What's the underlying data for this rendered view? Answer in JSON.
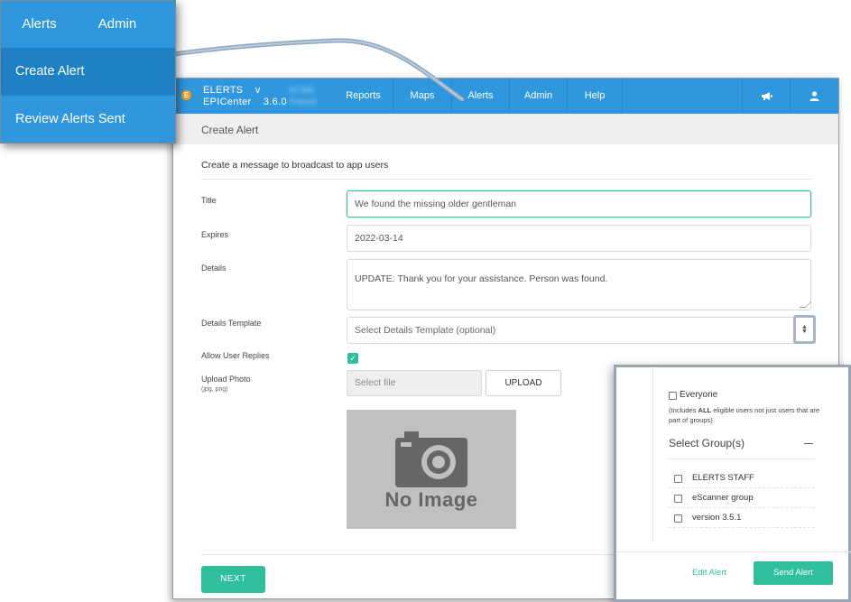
{
  "dropdown": {
    "tabs": [
      "Alerts",
      "Admin"
    ],
    "items": [
      "Create Alert",
      "Review Alerts Sent"
    ]
  },
  "navbar": {
    "logo_letter": "E",
    "brand_line1": "ELERTS",
    "brand_line2": "EPICenter",
    "version_label": "v",
    "version_number": "3.6.0",
    "org_line1": "ACME",
    "org_line2": "Transit",
    "items": [
      "Reports",
      "Maps",
      "Alerts",
      "Admin",
      "Help"
    ],
    "icons": [
      "megaphone-icon",
      "user-icon"
    ]
  },
  "page": {
    "header_title": "Create Alert",
    "intro": "Create a message to broadcast to app users"
  },
  "form": {
    "title_label": "Title",
    "title_value": "We found the missing older gentleman",
    "expires_label": "Expires",
    "expires_value": "2022-03-14",
    "details_label": "Details",
    "details_value": "UPDATE:  Thank you for your assistance.  Person was found.",
    "template_label": "Details Template",
    "template_placeholder": "Select Details Template (optional)",
    "replies_label": "Allow User Replies",
    "replies_checked": true,
    "photo_label": "Upload Photo",
    "photo_sublabel": "(jpg, png)",
    "file_placeholder": "Select file",
    "upload_label": "UPLOAD",
    "no_image_text": "No Image",
    "next_label": "NEXT"
  },
  "recipients": {
    "everyone_label": "Everyone",
    "everyone_note_prefix": "(Includes ",
    "everyone_note_bold": "ALL",
    "everyone_note_suffix": " eligible users not just users that are part of groups)",
    "groups_title": "Select Group(s)",
    "groups": [
      "ELERTS STAFF",
      "eScanner group",
      "version 3.5.1"
    ],
    "edit_label": "Edit Alert",
    "send_label": "Send Alert"
  },
  "colors": {
    "nav_blue": "#2e97dd",
    "accent_teal": "#2fbf9d",
    "logo_orange": "#f39a1e"
  }
}
